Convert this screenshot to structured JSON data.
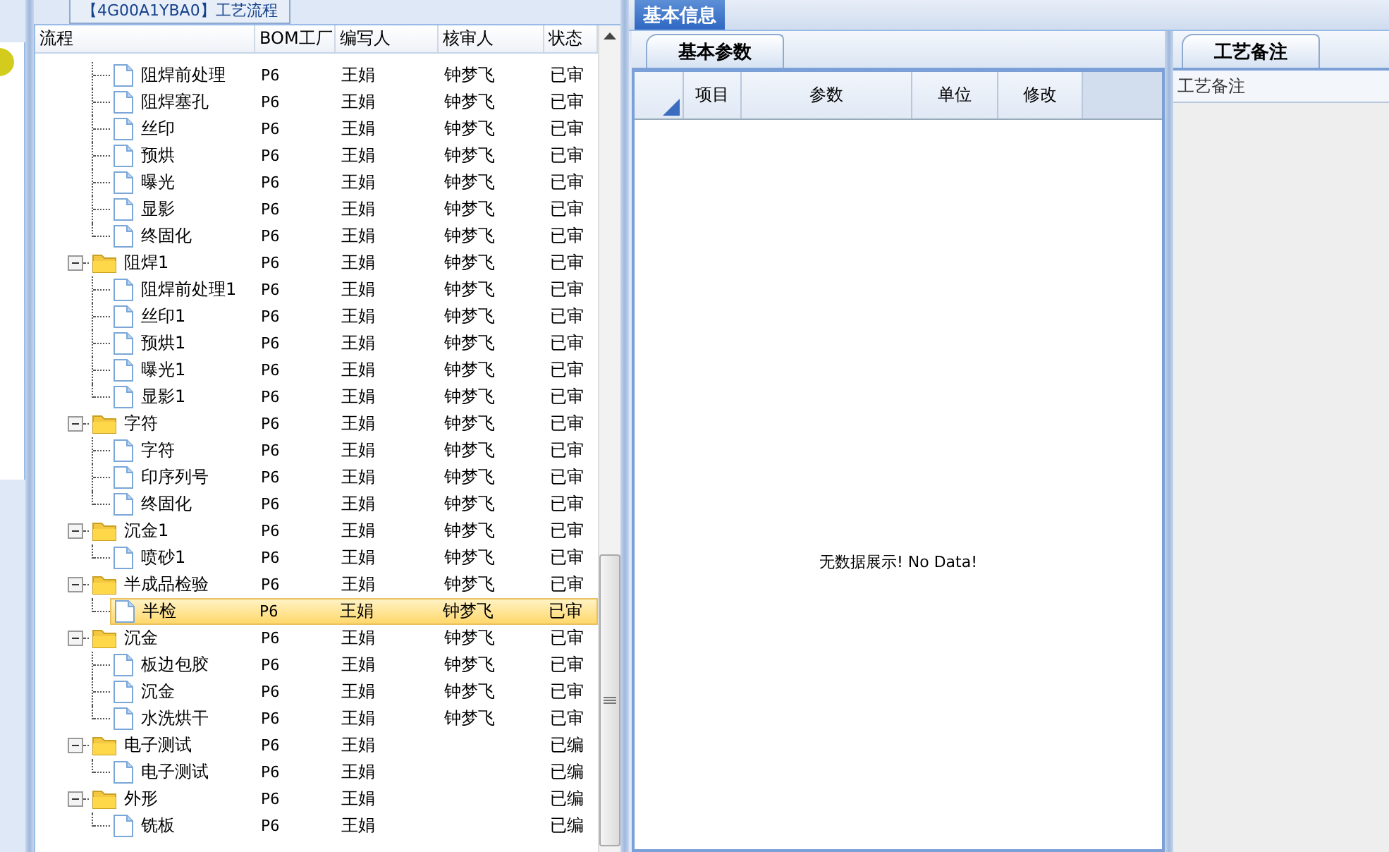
{
  "left_panel": {
    "title": "【4G00A1YBA0】工艺流程",
    "columns": [
      "流程",
      "BOM工厂",
      "编写人",
      "核审人",
      "状态"
    ],
    "tree": [
      {
        "kind": "file",
        "label": "阻焊前处理",
        "bom": "P6",
        "writer": "王娟",
        "reviewer": "钟梦飞",
        "status": "已审",
        "selected": false
      },
      {
        "kind": "file",
        "label": "阻焊塞孔",
        "bom": "P6",
        "writer": "王娟",
        "reviewer": "钟梦飞",
        "status": "已审",
        "selected": false
      },
      {
        "kind": "file",
        "label": "丝印",
        "bom": "P6",
        "writer": "王娟",
        "reviewer": "钟梦飞",
        "status": "已审",
        "selected": false
      },
      {
        "kind": "file",
        "label": "预烘",
        "bom": "P6",
        "writer": "王娟",
        "reviewer": "钟梦飞",
        "status": "已审",
        "selected": false
      },
      {
        "kind": "file",
        "label": "曝光",
        "bom": "P6",
        "writer": "王娟",
        "reviewer": "钟梦飞",
        "status": "已审",
        "selected": false
      },
      {
        "kind": "file",
        "label": "显影",
        "bom": "P6",
        "writer": "王娟",
        "reviewer": "钟梦飞",
        "status": "已审",
        "selected": false
      },
      {
        "kind": "file",
        "label": "终固化",
        "bom": "P6",
        "writer": "王娟",
        "reviewer": "钟梦飞",
        "status": "已审",
        "selected": false
      },
      {
        "kind": "folder",
        "label": "阻焊1",
        "bom": "P6",
        "writer": "王娟",
        "reviewer": "钟梦飞",
        "status": "已审",
        "selected": false,
        "expanded": true,
        "children": [
          {
            "kind": "file",
            "label": "阻焊前处理1",
            "bom": "P6",
            "writer": "王娟",
            "reviewer": "钟梦飞",
            "status": "已审",
            "selected": false
          },
          {
            "kind": "file",
            "label": "丝印1",
            "bom": "P6",
            "writer": "王娟",
            "reviewer": "钟梦飞",
            "status": "已审",
            "selected": false
          },
          {
            "kind": "file",
            "label": "预烘1",
            "bom": "P6",
            "writer": "王娟",
            "reviewer": "钟梦飞",
            "status": "已审",
            "selected": false
          },
          {
            "kind": "file",
            "label": "曝光1",
            "bom": "P6",
            "writer": "王娟",
            "reviewer": "钟梦飞",
            "status": "已审",
            "selected": false
          },
          {
            "kind": "file",
            "label": "显影1",
            "bom": "P6",
            "writer": "王娟",
            "reviewer": "钟梦飞",
            "status": "已审",
            "selected": false
          }
        ]
      },
      {
        "kind": "folder",
        "label": "字符",
        "bom": "P6",
        "writer": "王娟",
        "reviewer": "钟梦飞",
        "status": "已审",
        "selected": false,
        "expanded": true,
        "children": [
          {
            "kind": "file",
            "label": "字符",
            "bom": "P6",
            "writer": "王娟",
            "reviewer": "钟梦飞",
            "status": "已审",
            "selected": false
          },
          {
            "kind": "file",
            "label": "印序列号",
            "bom": "P6",
            "writer": "王娟",
            "reviewer": "钟梦飞",
            "status": "已审",
            "selected": false
          },
          {
            "kind": "file",
            "label": "终固化",
            "bom": "P6",
            "writer": "王娟",
            "reviewer": "钟梦飞",
            "status": "已审",
            "selected": false
          }
        ]
      },
      {
        "kind": "folder",
        "label": "沉金1",
        "bom": "P6",
        "writer": "王娟",
        "reviewer": "钟梦飞",
        "status": "已审",
        "selected": false,
        "expanded": true,
        "children": [
          {
            "kind": "file",
            "label": "喷砂1",
            "bom": "P6",
            "writer": "王娟",
            "reviewer": "钟梦飞",
            "status": "已审",
            "selected": false
          }
        ]
      },
      {
        "kind": "folder",
        "label": "半成品检验",
        "bom": "P6",
        "writer": "王娟",
        "reviewer": "钟梦飞",
        "status": "已审",
        "selected": false,
        "expanded": true,
        "children": [
          {
            "kind": "file",
            "label": "半检",
            "bom": "P6",
            "writer": "王娟",
            "reviewer": "钟梦飞",
            "status": "已审",
            "selected": true
          }
        ]
      },
      {
        "kind": "folder",
        "label": "沉金",
        "bom": "P6",
        "writer": "王娟",
        "reviewer": "钟梦飞",
        "status": "已审",
        "selected": false,
        "expanded": true,
        "children": [
          {
            "kind": "file",
            "label": "板边包胶",
            "bom": "P6",
            "writer": "王娟",
            "reviewer": "钟梦飞",
            "status": "已审",
            "selected": false
          },
          {
            "kind": "file",
            "label": "沉金",
            "bom": "P6",
            "writer": "王娟",
            "reviewer": "钟梦飞",
            "status": "已审",
            "selected": false
          },
          {
            "kind": "file",
            "label": "水洗烘干",
            "bom": "P6",
            "writer": "王娟",
            "reviewer": "钟梦飞",
            "status": "已审",
            "selected": false
          }
        ]
      },
      {
        "kind": "folder",
        "label": "电子测试",
        "bom": "P6",
        "writer": "王娟",
        "status": "已编",
        "selected": false,
        "expanded": true,
        "children": [
          {
            "kind": "file",
            "label": "电子测试",
            "bom": "P6",
            "writer": "王娟",
            "status": "已编",
            "selected": false
          }
        ]
      },
      {
        "kind": "folder",
        "label": "外形",
        "bom": "P6",
        "writer": "王娟",
        "status": "已编",
        "selected": false,
        "expanded": true,
        "children": [
          {
            "kind": "file",
            "label": "铣板",
            "bom": "P6",
            "writer": "王娟",
            "status": "已编",
            "selected": false
          }
        ]
      }
    ]
  },
  "right_panel": {
    "tab": "基本信息",
    "params": {
      "tab": "基本参数",
      "columns": [
        "项目",
        "参数",
        "单位",
        "修改"
      ],
      "empty_message": "无数据展示! No Data!"
    },
    "notes": {
      "tab": "工艺备注",
      "label": "工艺备注"
    }
  }
}
